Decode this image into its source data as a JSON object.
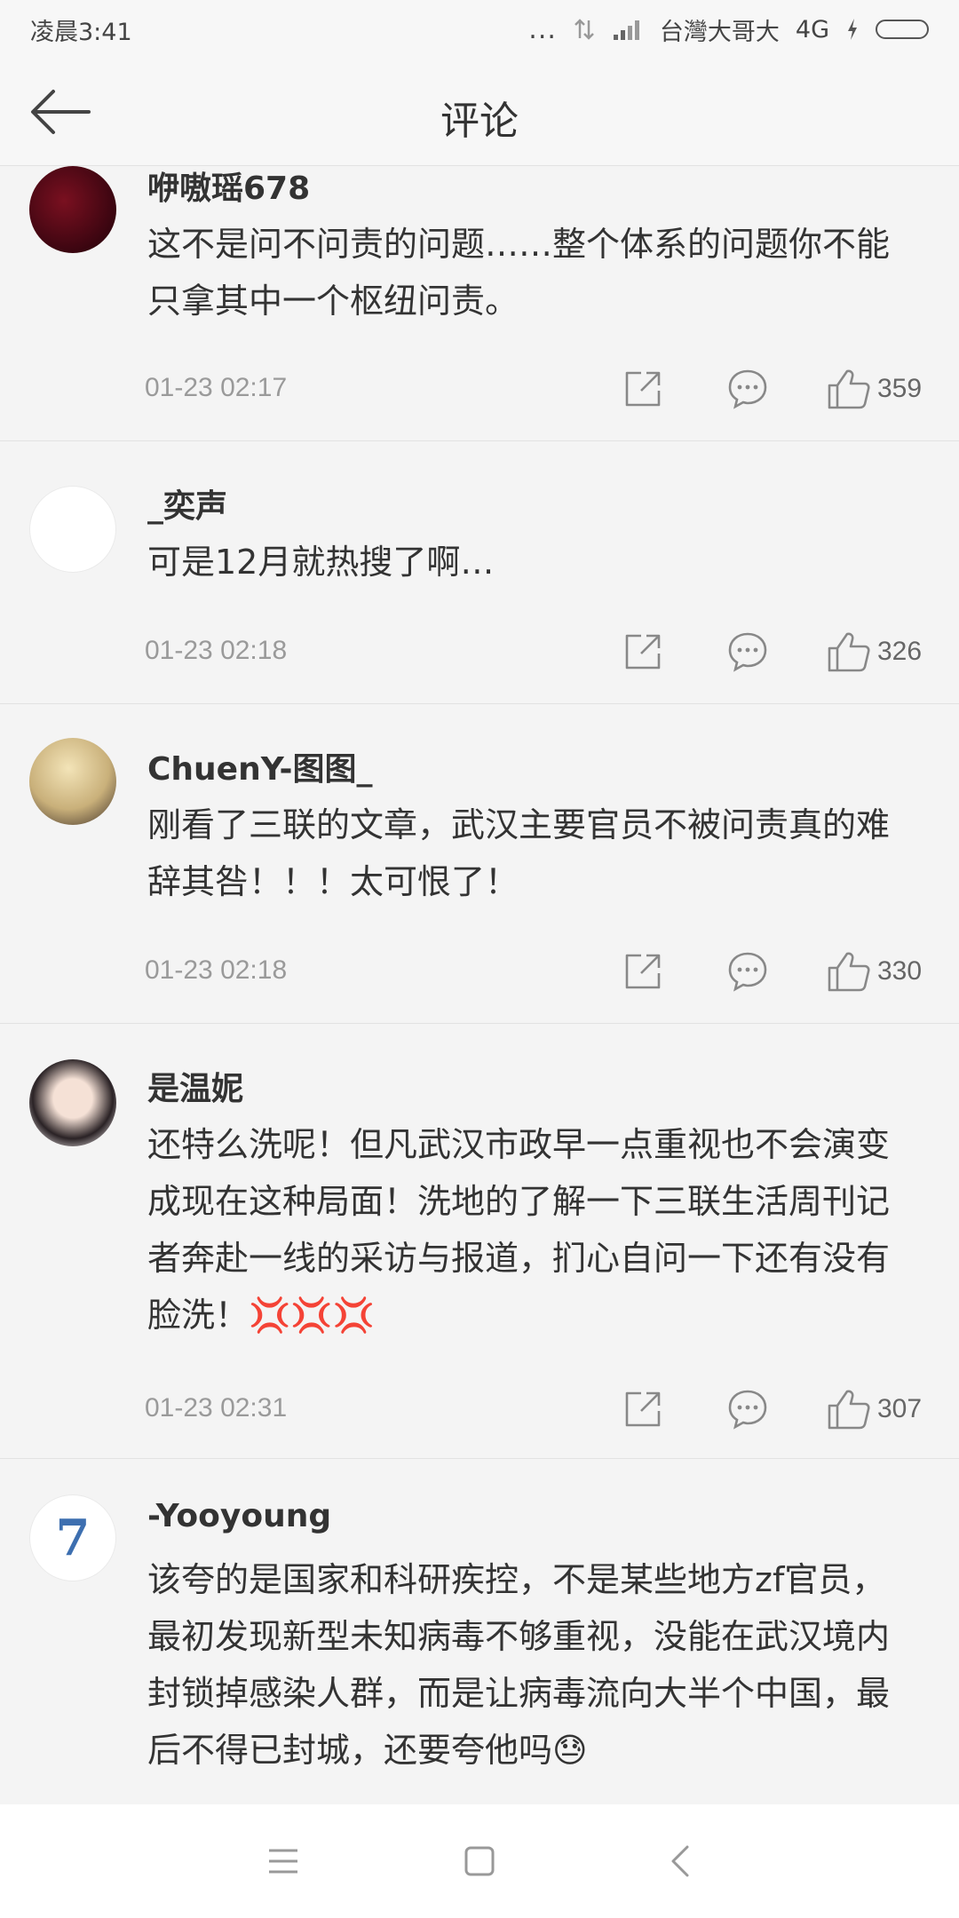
{
  "status": {
    "time": "凌晨3:41",
    "dots": "...",
    "carrier": "台灣大哥大",
    "network": "4G"
  },
  "header": {
    "title": "评论",
    "back_icon": "arrow-left-icon"
  },
  "comments": [
    {
      "username": "咿嗷瑶678",
      "text": "这不是问不问责的问题……整个体系的问题你不能只拿其中一个枢纽问责。",
      "time": "01-23 02:17",
      "likes": "359",
      "avatar": "dark-red-avatar"
    },
    {
      "username": "_奕声",
      "text": "可是12月就热搜了啊…",
      "time": "01-23 02:18",
      "likes": "326",
      "avatar": "blank-avatar"
    },
    {
      "username": "ChuenY-图图_",
      "text": "刚看了三联的文章，武汉主要官员不被问责真的难辞其咎！！！太可恨了！",
      "time": "01-23 02:18",
      "likes": "330",
      "avatar": "anime-avatar"
    },
    {
      "username": "是温妮",
      "text": "还特么洗呢！但凡武汉市政早一点重视也不会演变成现在这种局面！洗地的了解一下三联生活周刊记者奔赴一线的采访与报道，扪心自问一下还有没有脸洗！",
      "emoji": "💢💢💢",
      "time": "01-23 02:31",
      "likes": "307",
      "avatar": "girl-avatar"
    },
    {
      "username": "-Yooyoung",
      "text": "该夸的是国家和科研疾控，不是某些地方zf官员，最初发现新型未知病毒不够重视，没能在武汉境内封锁掉感染人群，而是让病毒流向大半个中国，最后不得已封城，还要夸他吗",
      "emoji": "😓",
      "avatar_text": "7",
      "avatar": "number-seven-avatar"
    }
  ]
}
